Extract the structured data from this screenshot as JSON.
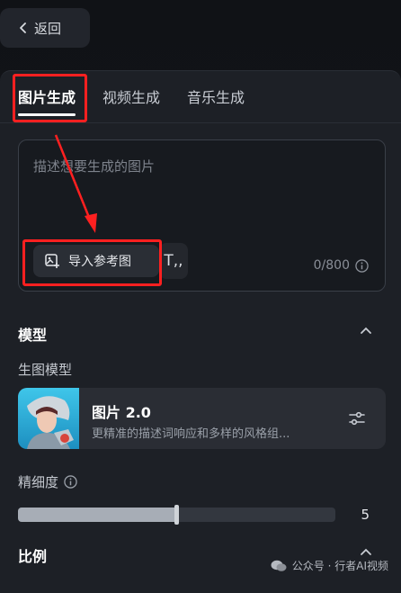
{
  "header": {
    "back_label": "返回"
  },
  "tabs": [
    {
      "label": "图片生成",
      "active": true
    },
    {
      "label": "视频生成",
      "active": false
    },
    {
      "label": "音乐生成",
      "active": false
    }
  ],
  "prompt": {
    "placeholder": "描述想要生成的图片",
    "value": "",
    "ref_button_label": "导入参考图",
    "text_button_label": "T,,",
    "counter": "0/800"
  },
  "model_section": {
    "title": "模型",
    "sub_label": "生图模型",
    "model_name": "图片 2.0",
    "model_desc": "更精准的描述词响应和多样的风格组..."
  },
  "detail_section": {
    "label": "精细度",
    "value": "5",
    "fill_fraction": 0.5
  },
  "ratio_section": {
    "title": "比例"
  },
  "watermark": {
    "text": "公众号 · 行者AI视频"
  },
  "colors": {
    "annotation": "#ff2020",
    "accent": "#ffffff"
  }
}
